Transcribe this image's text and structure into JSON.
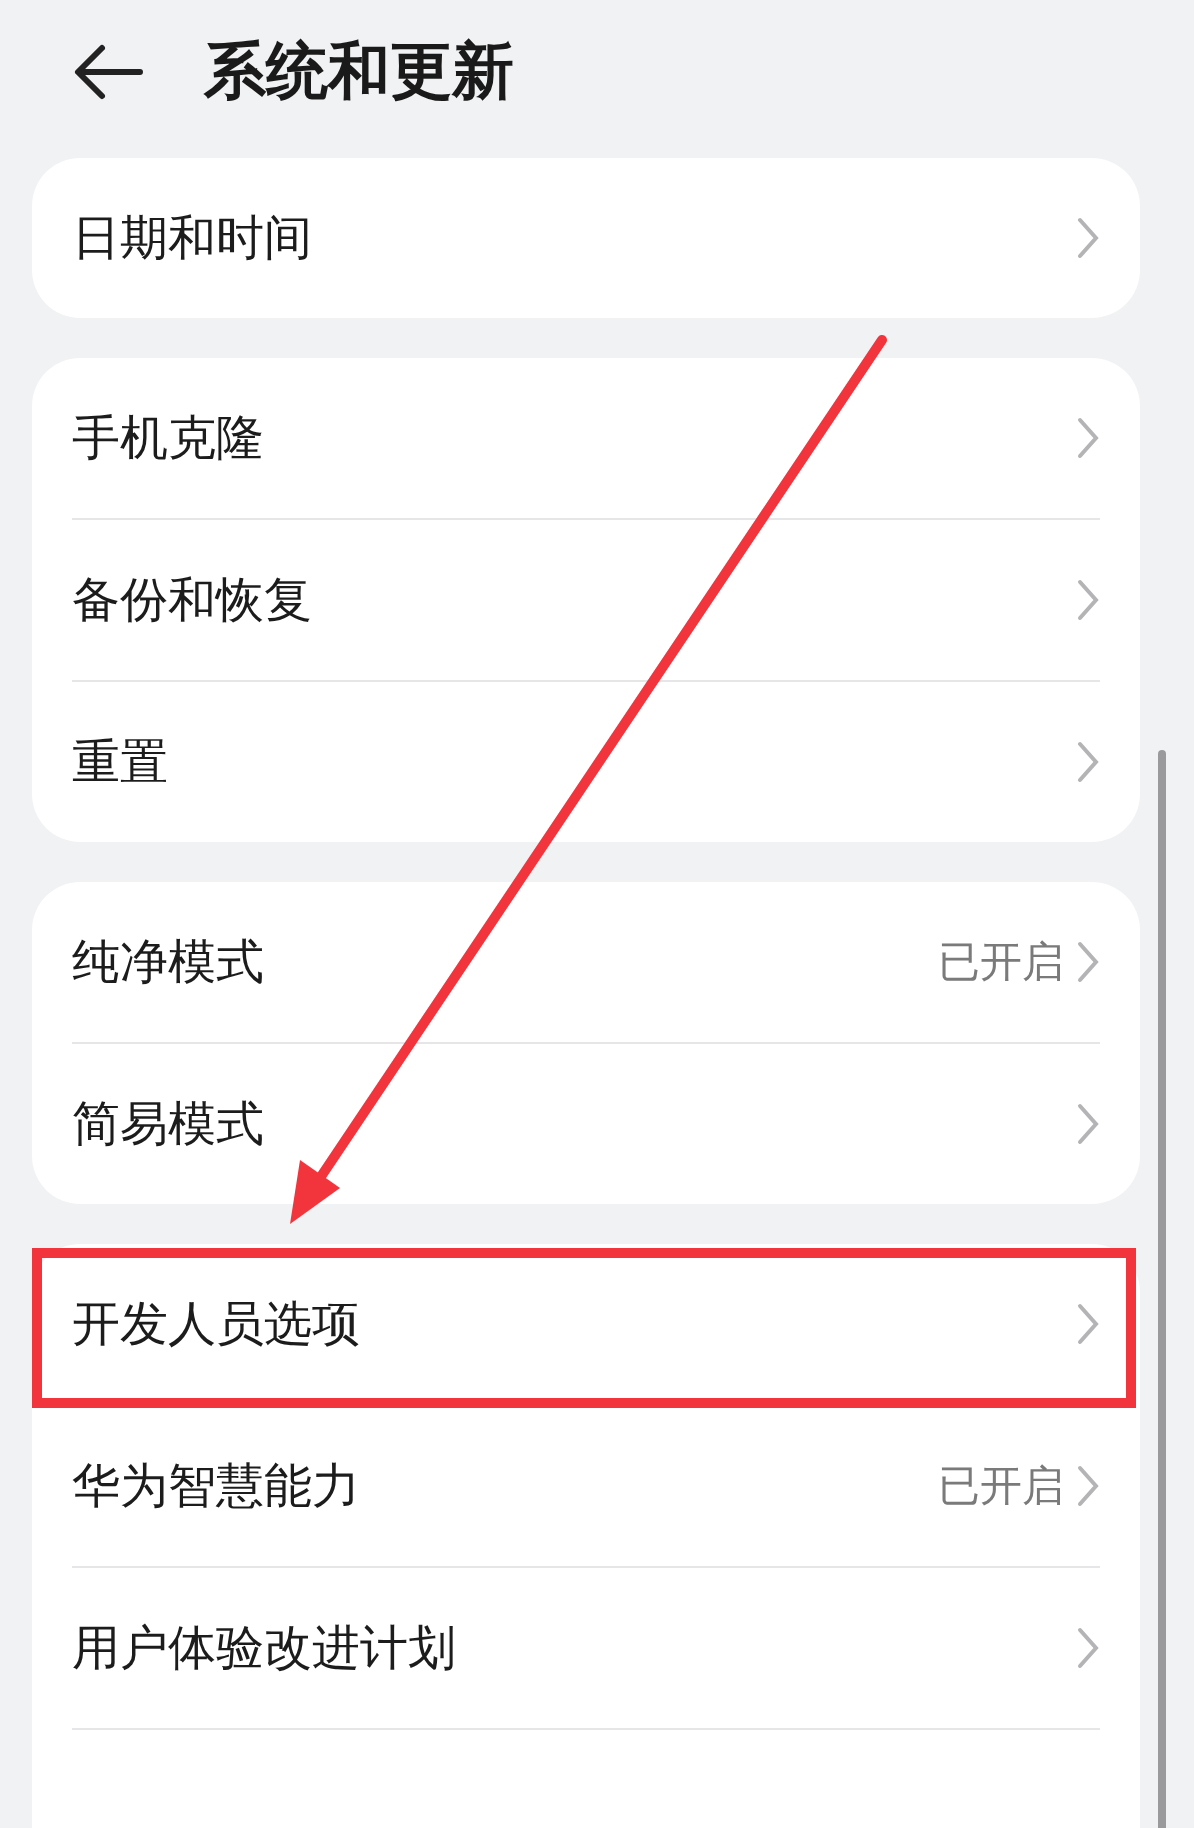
{
  "header": {
    "title": "系统和更新"
  },
  "groups": [
    {
      "items": [
        {
          "label": "日期和时间",
          "highlighted": false
        }
      ]
    },
    {
      "items": [
        {
          "label": "手机克隆",
          "highlighted": false
        },
        {
          "label": "备份和恢复",
          "highlighted": false
        },
        {
          "label": "重置",
          "highlighted": false
        }
      ]
    },
    {
      "items": [
        {
          "label": "纯净模式",
          "value": "已开启",
          "highlighted": false
        },
        {
          "label": "简易模式",
          "highlighted": false
        }
      ]
    },
    {
      "items": [
        {
          "label": "开发人员选项",
          "highlighted": true
        },
        {
          "label": "华为智慧能力",
          "value": "已开启",
          "highlighted": false
        },
        {
          "label": "用户体验改进计划",
          "highlighted": false
        }
      ]
    }
  ]
}
